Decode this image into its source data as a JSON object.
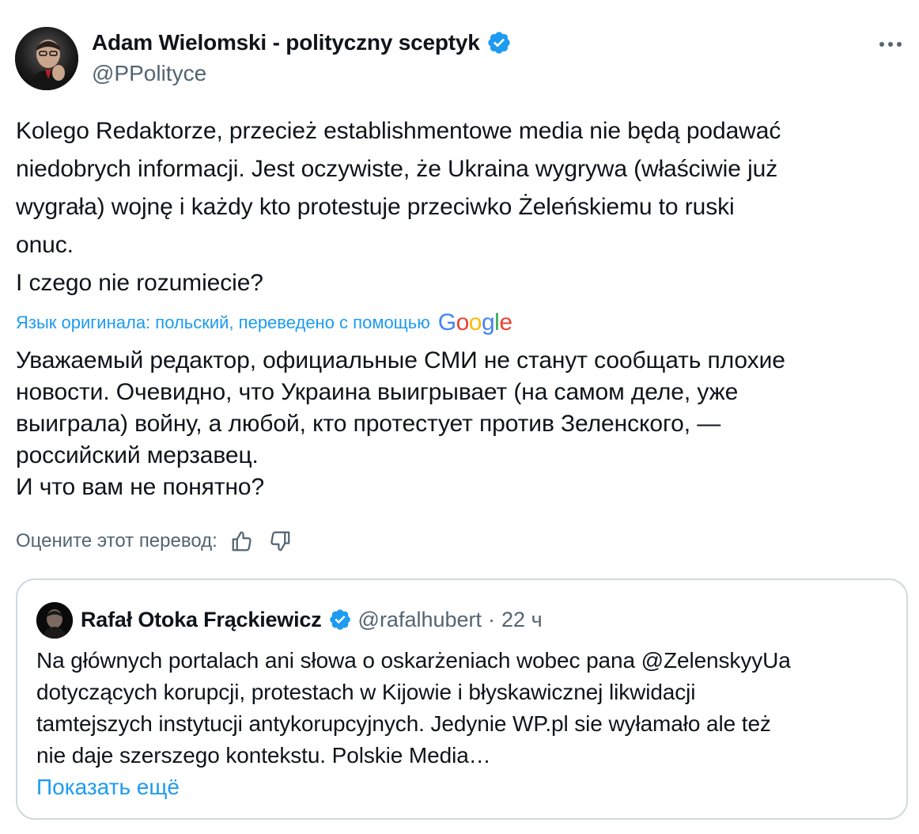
{
  "author": {
    "name": "Adam Wielomski - polityczny sceptyk",
    "handle": "@PPolityce"
  },
  "tweet": {
    "original_text": "Kolego Redaktorze, przecież establishmentowe media nie będą podawać\nniedobrych informacji. Jest oczywiste, że Ukraina wygrywa (właściwie już\nwygrała) wojnę i każdy kto protestuje przeciwko Żeleńskiemu to ruski\nonuc.\nI czego nie rozumiecie?",
    "translation_note": "Язык оригинала: польский, переведено с помощью",
    "translation_provider": {
      "letters": [
        "G",
        "o",
        "o",
        "g",
        "l",
        "e"
      ],
      "colors": [
        "#4285f4",
        "#ea4335",
        "#fbbc05",
        "#4285f4",
        "#34a853",
        "#ea4335"
      ]
    },
    "translated_text": "Уважаемый редактор, официальные СМИ не станут сообщать плохие\nновости. Очевидно, что Украина выигрывает (на самом деле, уже\nвыиграла) войну, а любой, кто протестует против Зеленского, —\nроссийский мерзавец.\nИ что вам не понятно?",
    "rate_label": "Оцените этот перевод:",
    "icons": {
      "more": "more-horizontal-icon",
      "verified": "verified-badge-icon",
      "thumbs_up": "thumbs-up-icon",
      "thumbs_down": "thumbs-down-icon"
    }
  },
  "quoted_tweet": {
    "name": "Rafał Otoka Frąckiewicz",
    "handle": "@rafalhubert",
    "separator": "·",
    "time": "22 ч",
    "text": "Na głównych portalach ani słowa o oskarżeniach wobec pana @ZelenskyyUa\ndotyczących korupcji, protestach w Kijowie i błyskawicznej likwidacji\ntamtejszych instytucji antykorupcyjnych. Jedynie WP.pl sie wyłamało ale też\nnie daje szerszego kontekstu. Polskie Media…",
    "show_more": "Показать ещё"
  },
  "colors": {
    "text_primary": "#0f1419",
    "text_secondary": "#536471",
    "link_blue": "#1d9bf0",
    "border": "#cfd9de"
  }
}
